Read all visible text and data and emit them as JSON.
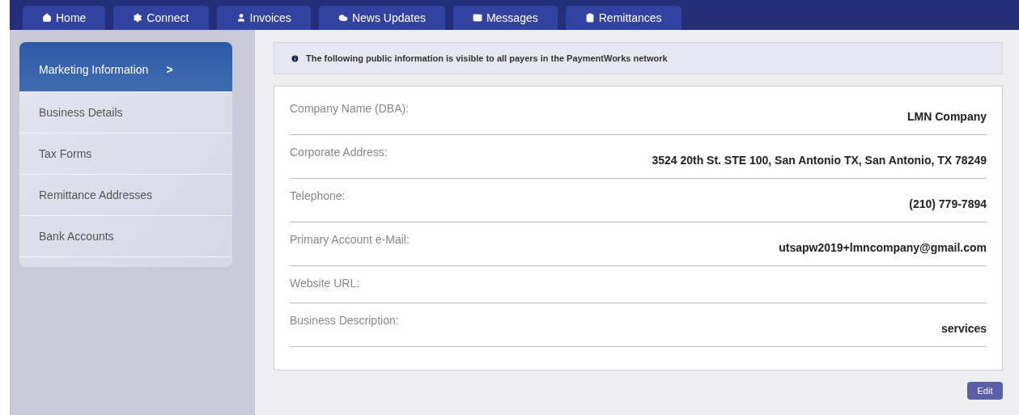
{
  "nav_tabs": [
    {
      "label": "Home",
      "selected": false
    },
    {
      "label": "Connect",
      "selected": false
    },
    {
      "label": "Invoices",
      "selected": false
    },
    {
      "label": "News Updates",
      "selected": false
    },
    {
      "label": "Messages",
      "selected": false
    },
    {
      "label": "Remittances",
      "selected": false
    }
  ],
  "sidebar": {
    "items": [
      {
        "label": "Marketing Information",
        "selected": true,
        "arrow": ">"
      },
      {
        "label": "Business Details",
        "selected": false
      },
      {
        "label": "Tax Forms",
        "selected": false
      },
      {
        "label": "Remittance Addresses",
        "selected": false
      },
      {
        "label": "Bank Accounts",
        "selected": false
      }
    ]
  },
  "notice": "The following public information is visible to all payers in the PaymentWorks network",
  "fields": [
    {
      "label": "Company Name (DBA):",
      "value": "LMN Company"
    },
    {
      "label": "Corporate Address:",
      "value": "3524 20th St. STE 100, San Antonio TX, San Antonio, TX 78249"
    },
    {
      "label": "Telephone:",
      "value": "(210) 779-7894"
    },
    {
      "label": "Primary Account e-Mail:",
      "value": "utsapw2019+lmncompany@gmail.com"
    },
    {
      "label": "Website URL:"
    },
    {
      "label": "Business Description:",
      "value": "services"
    }
  ],
  "edit_button": "Edit"
}
